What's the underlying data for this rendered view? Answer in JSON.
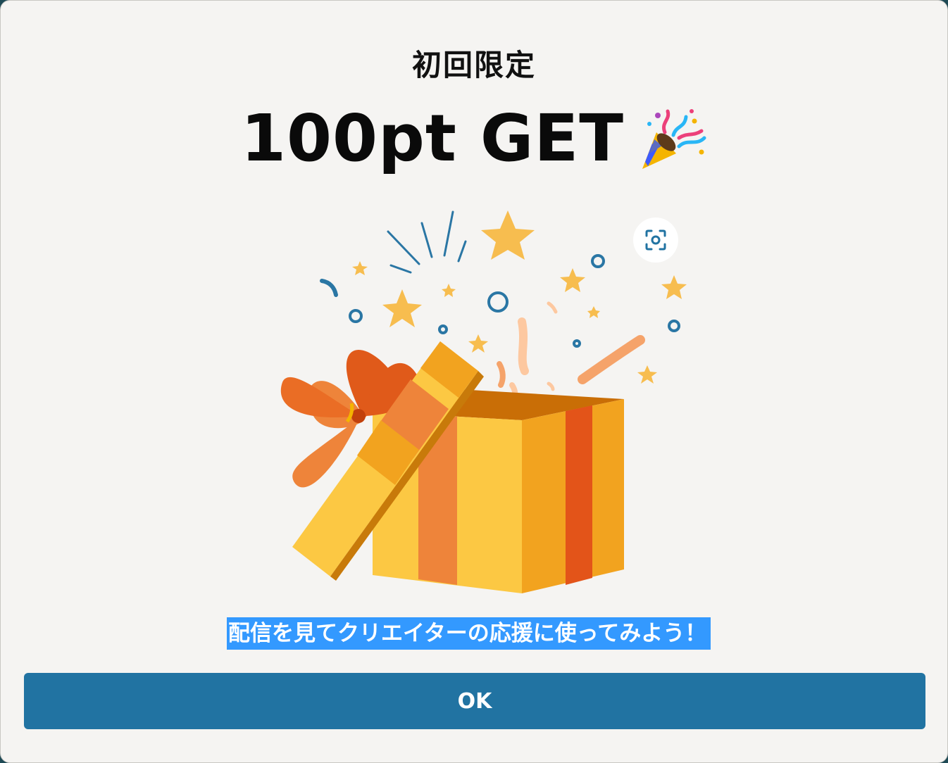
{
  "dialog": {
    "title": "初回限定",
    "headline": "100pt GET",
    "headline_icon": "party-popper-icon",
    "illustration": "open-gift-box",
    "lens_icon": "visual-search-icon",
    "message": "配信を見てクリエイターの応援に使ってみよう！",
    "ok_label": "OK"
  },
  "colors": {
    "background": "#f5f4f2",
    "button": "#2173a2",
    "selection": "#3399ff",
    "box_yellow": "#fcc843",
    "box_orange": "#f2a31f",
    "ribbon": "#e35419"
  }
}
